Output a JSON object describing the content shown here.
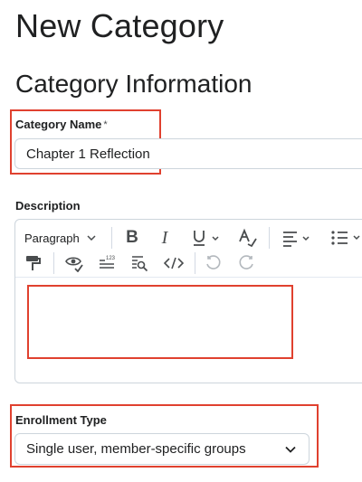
{
  "page": {
    "title": "New Category",
    "section_title": "Category Information"
  },
  "category_name": {
    "label": "Category Name",
    "required_marker": "*",
    "value": "Chapter 1 Reflection"
  },
  "description": {
    "label": "Description",
    "toolbar": {
      "paragraph_label": "Paragraph",
      "icons": [
        "bold-icon",
        "italic-icon",
        "underline-icon",
        "text-color-icon",
        "align-icon",
        "list-icon",
        "format-painter-icon",
        "accessibility-check-icon",
        "word-count-icon",
        "find-replace-icon",
        "source-code-icon",
        "undo-icon",
        "redo-icon"
      ]
    },
    "value": ""
  },
  "enrollment_type": {
    "label": "Enrollment Type",
    "value": "Single user, member-specific groups"
  },
  "colors": {
    "callout": "#e0412f",
    "text": "#202122",
    "border": "#cdd5dc"
  }
}
